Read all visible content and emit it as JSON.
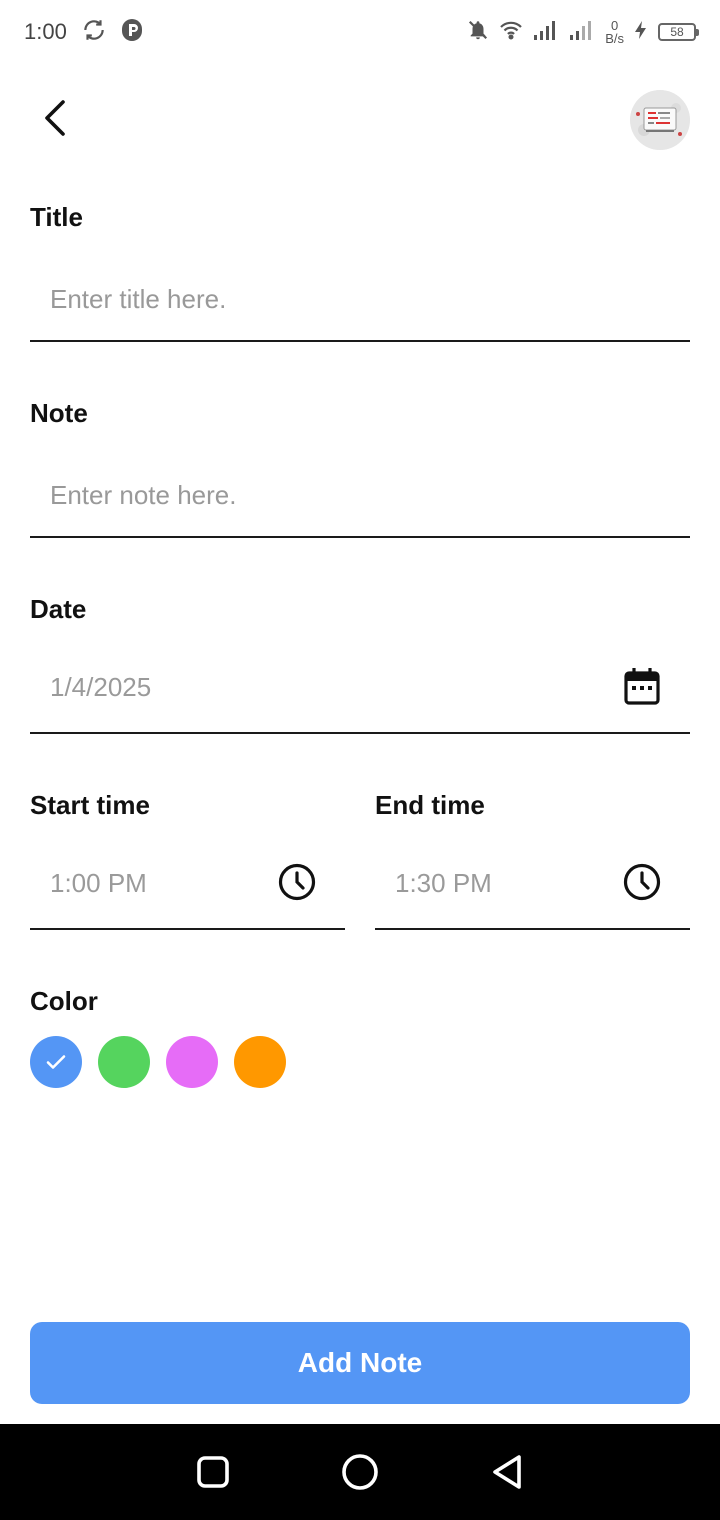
{
  "status_bar": {
    "time": "1:00",
    "net_speed_value": "0",
    "net_speed_unit": "B/s",
    "battery_level": "58"
  },
  "form": {
    "title_label": "Title",
    "title_placeholder": "Enter title here.",
    "note_label": "Note",
    "note_placeholder": "Enter note here.",
    "date_label": "Date",
    "date_value": "1/4/2025",
    "start_time_label": "Start time",
    "start_time_value": "1:00 PM",
    "end_time_label": "End time",
    "end_time_value": "1:30 PM",
    "color_label": "Color",
    "colors": [
      {
        "name": "blue",
        "hex": "#5496F5",
        "selected": true
      },
      {
        "name": "green",
        "hex": "#55D45E",
        "selected": false
      },
      {
        "name": "violet",
        "hex": "#E66CF7",
        "selected": false
      },
      {
        "name": "orange",
        "hex": "#FF9800",
        "selected": false
      }
    ]
  },
  "actions": {
    "add_note_label": "Add Note"
  },
  "icons": {
    "back": "back-arrow-icon",
    "calendar": "calendar-icon",
    "clock": "clock-icon",
    "check": "check-icon"
  },
  "theme": {
    "primary": "#5496F5"
  }
}
